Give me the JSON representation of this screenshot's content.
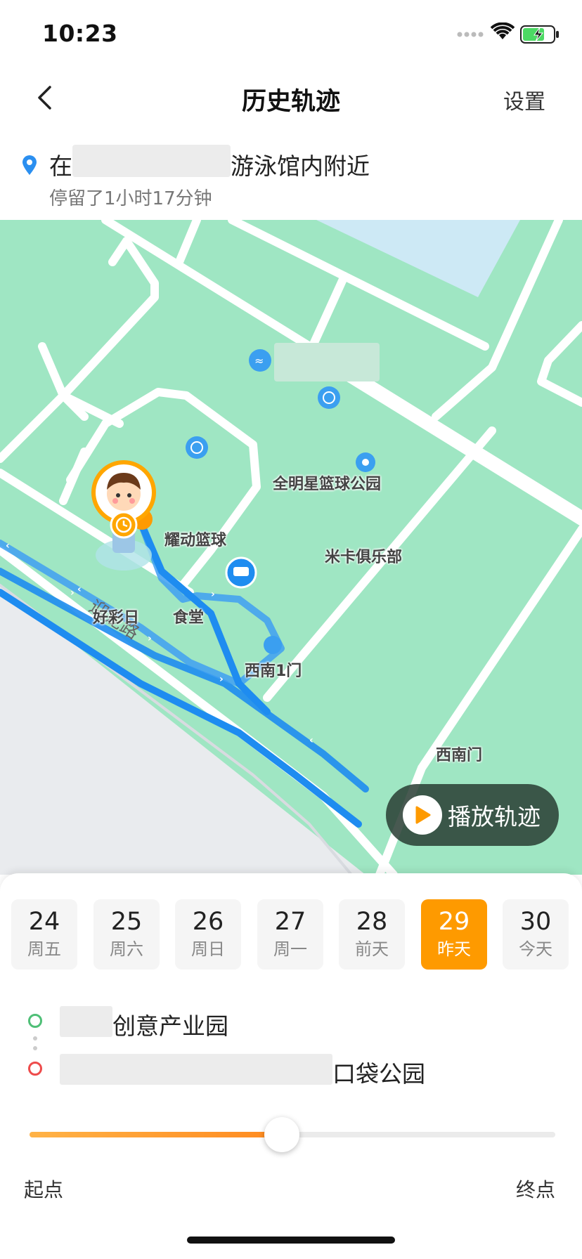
{
  "status_bar": {
    "time": "10:23"
  },
  "nav": {
    "title": "历史轨迹",
    "settings_label": "设置"
  },
  "location": {
    "prefix": "在",
    "suffix": "游泳馆内附近",
    "stay": "停留了1小时17分钟"
  },
  "map": {
    "pois": {
      "quanmingxing": "全明星篮球公园",
      "yaodong": "耀动篮球",
      "mika": "米卡俱乐部",
      "haocai": "好彩日",
      "shitang": "食堂",
      "xinan1": "西南1门",
      "xinan": "西南门",
      "road": "迎龙路"
    },
    "play_label": "播放轨迹",
    "colors": {
      "land": "#9fe6c3",
      "road": "#ffffff",
      "water": "#cde9f5",
      "track": "#1e8cf0",
      "accent": "#fe9a00"
    }
  },
  "dates": [
    {
      "num": "24",
      "day": "周五",
      "active": false
    },
    {
      "num": "25",
      "day": "周六",
      "active": false
    },
    {
      "num": "26",
      "day": "周日",
      "active": false
    },
    {
      "num": "27",
      "day": "周一",
      "active": false
    },
    {
      "num": "28",
      "day": "前天",
      "active": false
    },
    {
      "num": "29",
      "day": "昨天",
      "active": true
    },
    {
      "num": "30",
      "day": "今天",
      "active": false
    }
  ],
  "route": {
    "start_label": "创意产业园",
    "end_label": "口袋公园"
  },
  "slider": {
    "progress": 0.48,
    "start_label": "起点",
    "end_label": "终点"
  }
}
